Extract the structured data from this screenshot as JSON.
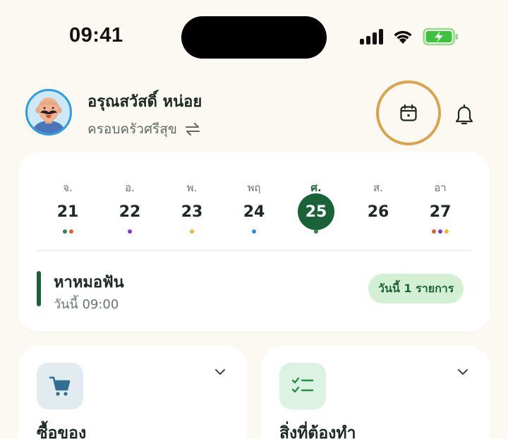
{
  "status_bar": {
    "time": "09:41",
    "icons": [
      "signal-icon",
      "wifi-icon",
      "battery-charging-icon"
    ],
    "battery_color": "#3dc23d"
  },
  "header": {
    "user_name": "อรุณสวัสดิ์ หน่อย",
    "family_name": "ครอบครัวศรีสุข",
    "switch_icon": "switch-icon",
    "calendar_icon": "calendar-icon",
    "bell_icon": "bell-icon",
    "highlight_color": "#dca34d"
  },
  "week": {
    "selected_color": "#1a6339",
    "days": [
      {
        "label": "จ.",
        "num": "21",
        "dots": [
          "#2e8b4a",
          "#e0612a"
        ],
        "active": false
      },
      {
        "label": "อ.",
        "num": "22",
        "dots": [
          "#8a3cb4"
        ],
        "active": false
      },
      {
        "label": "พ.",
        "num": "23",
        "dots": [
          "#f0b82a"
        ],
        "active": false
      },
      {
        "label": "พฤ",
        "num": "24",
        "dots": [
          "#2a95d8"
        ],
        "active": false
      },
      {
        "label": "ศ.",
        "num": "25",
        "dots": [
          "#2e8b4a"
        ],
        "active": true
      },
      {
        "label": "ส.",
        "num": "26",
        "dots": [],
        "active": false
      },
      {
        "label": "อา",
        "num": "27",
        "dots": [
          "#e0612a",
          "#8a3cb4",
          "#f0b82a"
        ],
        "active": false
      }
    ]
  },
  "event": {
    "title": "หาหมอฟัน",
    "time": "วันนี้ 09:00",
    "badge": "วันนี้ 1 รายการ"
  },
  "cards": [
    {
      "title": "ซื้อของ",
      "icon": "cart-icon",
      "icon_bg": "#e2ebf0",
      "icon_color": "#2f6f8f"
    },
    {
      "title": "สิ่งที่ต้องทำ",
      "icon": "checklist-icon",
      "icon_bg": "#dcf3e4",
      "icon_color": "#2e8b4a"
    }
  ]
}
